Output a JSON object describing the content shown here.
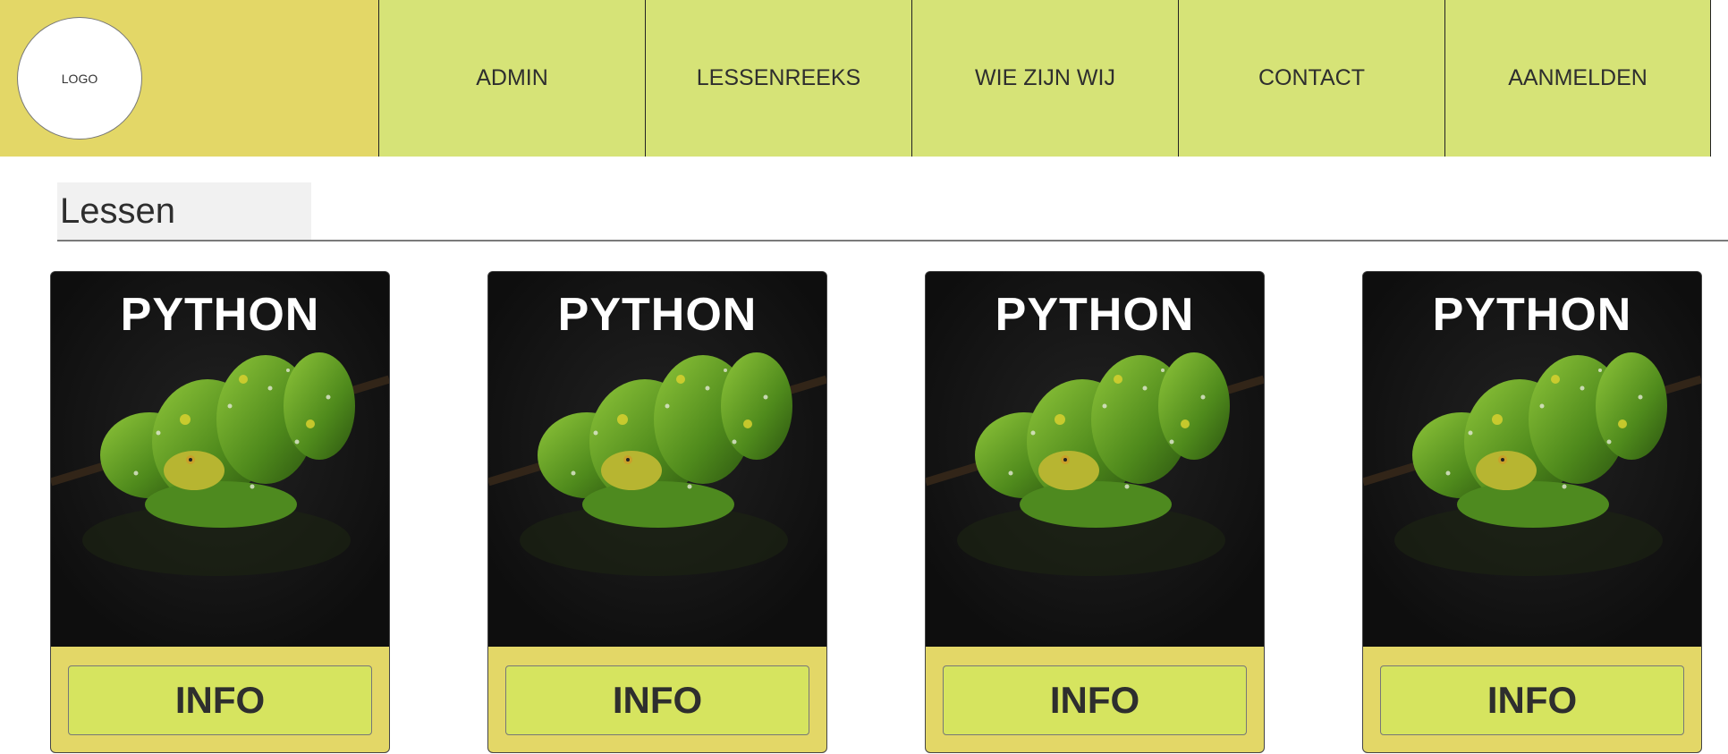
{
  "logo": {
    "label": "LOGO"
  },
  "nav": {
    "items": [
      {
        "label": "ADMIN"
      },
      {
        "label": "LESSENREEKS"
      },
      {
        "label": "WIE ZIJN WIJ"
      },
      {
        "label": "CONTACT"
      },
      {
        "label": "AANMELDEN"
      }
    ]
  },
  "section": {
    "title": "Lessen"
  },
  "cards": [
    {
      "title": "PYTHON",
      "button": "INFO",
      "image_icon": "green-python-snake-image"
    },
    {
      "title": "PYTHON",
      "button": "INFO",
      "image_icon": "green-python-snake-image"
    },
    {
      "title": "PYTHON",
      "button": "INFO",
      "image_icon": "green-python-snake-image"
    },
    {
      "title": "PYTHON",
      "button": "INFO",
      "image_icon": "green-python-snake-image"
    }
  ],
  "colors": {
    "header_yellow": "#e3d767",
    "nav_green": "#d6e377",
    "button_green": "#d6e45f",
    "card_dark": "#151515"
  }
}
